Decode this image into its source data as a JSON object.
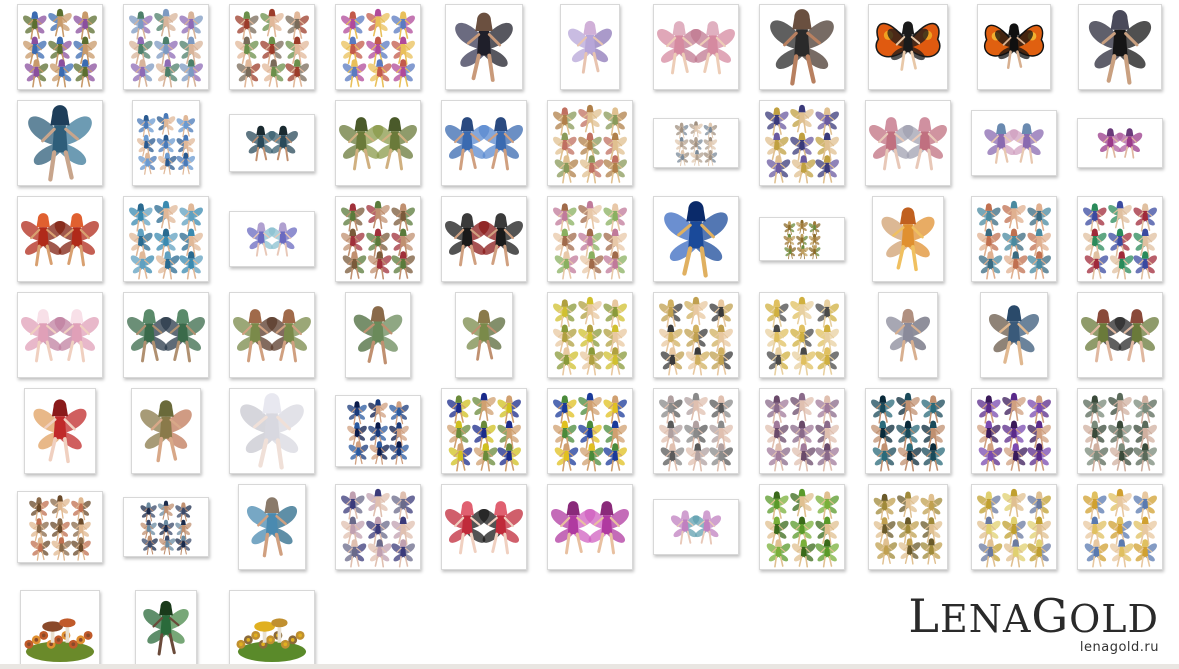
{
  "watermark": {
    "logo_initial": "L",
    "logo_middle": "ENA",
    "logo_g": "G",
    "logo_rest": "OLD",
    "site": "lenagold.ru"
  },
  "gallery": {
    "rows": [
      [
        {
          "kind": "collage",
          "palette": [
            "#5b6e2f",
            "#c89a6a",
            "#8a4f9e",
            "#3b6bb1"
          ]
        },
        {
          "kind": "collage",
          "palette": [
            "#7d9ac2",
            "#d8b49a",
            "#8e6bb5",
            "#4d7f6a"
          ]
        },
        {
          "kind": "collage",
          "palette": [
            "#9c3c2a",
            "#e1b89a",
            "#7a6b5a",
            "#6b8f4a"
          ]
        },
        {
          "kind": "collage",
          "palette": [
            "#b04a9a",
            "#e9c05a",
            "#5a7ac0",
            "#c35a4a"
          ]
        },
        {
          "kind": "single",
          "palette": [
            "#1f1f2a",
            "#c99a7a",
            "#3a3a55",
            "#6b5040"
          ]
        },
        {
          "kind": "single",
          "palette": [
            "#b7a6d8",
            "#e8c4b0",
            "#8e78b8",
            "#d0b0d8"
          ]
        },
        {
          "kind": "pair",
          "palette": [
            "#d58aa0",
            "#edcdb7",
            "#c07890",
            "#e0b0c0"
          ]
        },
        {
          "kind": "single",
          "palette": [
            "#2a2a2a",
            "#b88060",
            "#4a3a30",
            "#6a5040"
          ]
        },
        {
          "kind": "butterfly",
          "palette": [
            "#e05a10",
            "#f0a020",
            "#1a1a1a",
            "#e8c8a8"
          ]
        },
        {
          "kind": "butterfly",
          "palette": [
            "#e06010",
            "#f0b030",
            "#101010",
            "#d8b090"
          ]
        },
        {
          "kind": "single",
          "palette": [
            "#151515",
            "#c9a080",
            "#2a2a3a",
            "#4a4a5a"
          ]
        }
      ],
      [
        {
          "kind": "single",
          "palette": [
            "#2e5e7a",
            "#c8a58c",
            "#3c7a9a",
            "#1e3e5a"
          ]
        },
        {
          "kind": "collage",
          "palette": [
            "#4a7ab8",
            "#e0b898",
            "#6a9ad0",
            "#2a5a90"
          ]
        },
        {
          "kind": "pair",
          "palette": [
            "#2a4a5a",
            "#c09070",
            "#3a6070",
            "#1a2a30"
          ]
        },
        {
          "kind": "pair",
          "palette": [
            "#6a7a3a",
            "#d0b080",
            "#8a9a4a",
            "#4a5a2a"
          ]
        },
        {
          "kind": "pair",
          "palette": [
            "#3a6ab0",
            "#d0a080",
            "#5a8ad0",
            "#2a4a80"
          ]
        },
        {
          "kind": "collage",
          "palette": [
            "#b0804a",
            "#e0c090",
            "#8a9a5a",
            "#c07060"
          ]
        },
        {
          "kind": "collage",
          "palette": [
            "#a09080",
            "#e0c8b0",
            "#7a8a9a",
            "#b0a090"
          ]
        },
        {
          "kind": "collage",
          "palette": [
            "#3a3a7a",
            "#e0c090",
            "#6a5aa0",
            "#c0a040"
          ]
        },
        {
          "kind": "pair",
          "palette": [
            "#c07080",
            "#e8c8b8",
            "#a0a0b0",
            "#d090a0"
          ]
        },
        {
          "kind": "pair",
          "palette": [
            "#8a6ab0",
            "#e8c8b0",
            "#d0a0c0",
            "#6a8ab0"
          ]
        },
        {
          "kind": "pair",
          "palette": [
            "#9a3a8a",
            "#e0b8a0",
            "#b060a0",
            "#6a3a7a"
          ]
        }
      ],
      [
        {
          "kind": "pair",
          "palette": [
            "#b02a1a",
            "#d8a070",
            "#802010",
            "#e06030"
          ]
        },
        {
          "kind": "collage",
          "palette": [
            "#3a8ab0",
            "#e0b898",
            "#60a0c0",
            "#2a6a90"
          ]
        },
        {
          "kind": "pair",
          "palette": [
            "#6a6ac0",
            "#e8c8b8",
            "#8ac0d0",
            "#b0a0d0"
          ]
        },
        {
          "kind": "collage",
          "palette": [
            "#5a7a3a",
            "#c09070",
            "#7a5a3a",
            "#a0303a"
          ]
        },
        {
          "kind": "pair",
          "palette": [
            "#1a1a1a",
            "#d0a080",
            "#8a1a1a",
            "#3a3a3a"
          ]
        },
        {
          "kind": "collage",
          "palette": [
            "#c07a9a",
            "#e8c8a8",
            "#8ab060",
            "#a06a4a"
          ]
        },
        {
          "kind": "single",
          "palette": [
            "#1a4a9a",
            "#e0b060",
            "#3a6ac0",
            "#0a2a6a"
          ]
        },
        {
          "kind": "collage",
          "palette": [
            "#8a6a2a",
            "#a07a3a",
            "#6a8a3a",
            "#c0a060"
          ]
        },
        {
          "kind": "single",
          "palette": [
            "#e09030",
            "#f0c060",
            "#d0a070",
            "#c06020"
          ]
        },
        {
          "kind": "collage",
          "palette": [
            "#4a8aa0",
            "#e0b090",
            "#3a6a80",
            "#c07050"
          ]
        },
        {
          "kind": "collage",
          "palette": [
            "#3a4aa0",
            "#e0c0a0",
            "#a02a3a",
            "#2a8a5a"
          ]
        }
      ],
      [
        {
          "kind": "pair",
          "palette": [
            "#e0a0b8",
            "#f0d0c0",
            "#c080a0",
            "#f8e0e8"
          ]
        },
        {
          "kind": "pair",
          "palette": [
            "#3a6a4a",
            "#b09070",
            "#2a3a4a",
            "#5a8a6a"
          ]
        },
        {
          "kind": "pair",
          "palette": [
            "#7a8a4a",
            "#d0a080",
            "#5a3a2a",
            "#a06a4a"
          ]
        },
        {
          "kind": "single",
          "palette": [
            "#6a8a5a",
            "#c09070",
            "#4a6a3a",
            "#8a6a4a"
          ]
        },
        {
          "kind": "single",
          "palette": [
            "#7a8a4a",
            "#c09070",
            "#5a6a3a",
            "#8a7a4a"
          ]
        },
        {
          "kind": "collage",
          "palette": [
            "#d0c030",
            "#e8c8a0",
            "#8a9a3a",
            "#b0a040"
          ]
        },
        {
          "kind": "collage",
          "palette": [
            "#c0a050",
            "#e8c8a0",
            "#3a3a3a",
            "#d0b060"
          ]
        },
        {
          "kind": "collage",
          "palette": [
            "#d0b040",
            "#e8d0a0",
            "#4a4a4a",
            "#e0c060"
          ]
        },
        {
          "kind": "single",
          "palette": [
            "#8a8a9a",
            "#d8b090",
            "#6a6a7a",
            "#b09080"
          ]
        },
        {
          "kind": "single",
          "palette": [
            "#3a5a7a",
            "#e0b890",
            "#6a5a4a",
            "#2a4a6a"
          ]
        },
        {
          "kind": "pair",
          "palette": [
            "#6a7a3a",
            "#e0b8a0",
            "#2a2a2a",
            "#8a4a3a"
          ]
        }
      ],
      [
        {
          "kind": "single",
          "palette": [
            "#c02a2a",
            "#f0d0c0",
            "#e0a060",
            "#8a1a1a"
          ]
        },
        {
          "kind": "single",
          "palette": [
            "#8a7a4a",
            "#d8a888",
            "#c07a5a",
            "#6a6a3a"
          ]
        },
        {
          "kind": "single",
          "palette": [
            "#d8d8e0",
            "#f0e0d8",
            "#c8c8d0",
            "#e8e8f0"
          ]
        },
        {
          "kind": "collage",
          "palette": [
            "#1a3a7a",
            "#d0a080",
            "#2a5aa0",
            "#0a1a4a"
          ]
        },
        {
          "kind": "collage",
          "palette": [
            "#1a2a8a",
            "#d0a070",
            "#d0c020",
            "#6a8a3a"
          ]
        },
        {
          "kind": "collage",
          "palette": [
            "#1a3a9a",
            "#d0a070",
            "#e0c020",
            "#4a8a3a"
          ]
        },
        {
          "kind": "collage",
          "palette": [
            "#8a8a8a",
            "#e0c0b0",
            "#5a5a5a",
            "#b0a0a0"
          ]
        },
        {
          "kind": "collage",
          "palette": [
            "#8a6a8a",
            "#e0c0b0",
            "#a07a9a",
            "#6a4a6a"
          ]
        },
        {
          "kind": "collage",
          "palette": [
            "#1a4a5a",
            "#c09070",
            "#2a6a7a",
            "#0a2a3a"
          ]
        },
        {
          "kind": "collage",
          "palette": [
            "#5a2a8a",
            "#d0a080",
            "#7a4ab0",
            "#3a1a5a"
          ]
        },
        {
          "kind": "collage",
          "palette": [
            "#5a6a5a",
            "#d0b0a0",
            "#7a8a7a",
            "#3a4a3a"
          ]
        }
      ],
      [
        {
          "kind": "collage",
          "palette": [
            "#6a4a2a",
            "#e0b890",
            "#c07050",
            "#8a6a4a"
          ]
        },
        {
          "kind": "collage",
          "palette": [
            "#1a2a4a",
            "#c09070",
            "#3a4a6a",
            "#6a8aa0"
          ]
        },
        {
          "kind": "single",
          "palette": [
            "#4a8ab0",
            "#d0a080",
            "#2a6a8a",
            "#8a7a6a"
          ]
        },
        {
          "kind": "collage",
          "palette": [
            "#3a3a7a",
            "#e0c0b0",
            "#6a6a8a",
            "#c0a0b0"
          ]
        },
        {
          "kind": "pair",
          "palette": [
            "#c02a3a",
            "#f0d0c0",
            "#1a1a1a",
            "#e06070"
          ]
        },
        {
          "kind": "pair",
          "palette": [
            "#b03aa0",
            "#e8c0a0",
            "#d060c0",
            "#8a2a7a"
          ]
        },
        {
          "kind": "pair",
          "palette": [
            "#c080c0",
            "#e8c8b8",
            "#60a0b0",
            "#d0a0d0"
          ]
        },
        {
          "kind": "collage",
          "palette": [
            "#5a9a2a",
            "#e0c090",
            "#7ab03a",
            "#3a6a1a"
          ]
        },
        {
          "kind": "collage",
          "palette": [
            "#a08a3a",
            "#e0c090",
            "#c0a050",
            "#6a5a2a"
          ]
        },
        {
          "kind": "collage",
          "palette": [
            "#c0a030",
            "#e0c090",
            "#6a7aa0",
            "#e0d070"
          ]
        },
        {
          "kind": "collage",
          "palette": [
            "#d0a030",
            "#e8c8a0",
            "#5a7ab0",
            "#e0c060"
          ]
        }
      ],
      [
        {
          "kind": "scene",
          "palette": [
            "#8a4a2a",
            "#e09030",
            "#6a8a2a",
            "#c05a2a"
          ]
        },
        {
          "kind": "single",
          "palette": [
            "#2a6a3a",
            "#6a4a3a",
            "#4a8a4a",
            "#1a3a1a"
          ]
        },
        {
          "kind": "scene",
          "palette": [
            "#e0b020",
            "#8a6a3a",
            "#5a8a2a",
            "#c09030"
          ]
        }
      ]
    ]
  }
}
